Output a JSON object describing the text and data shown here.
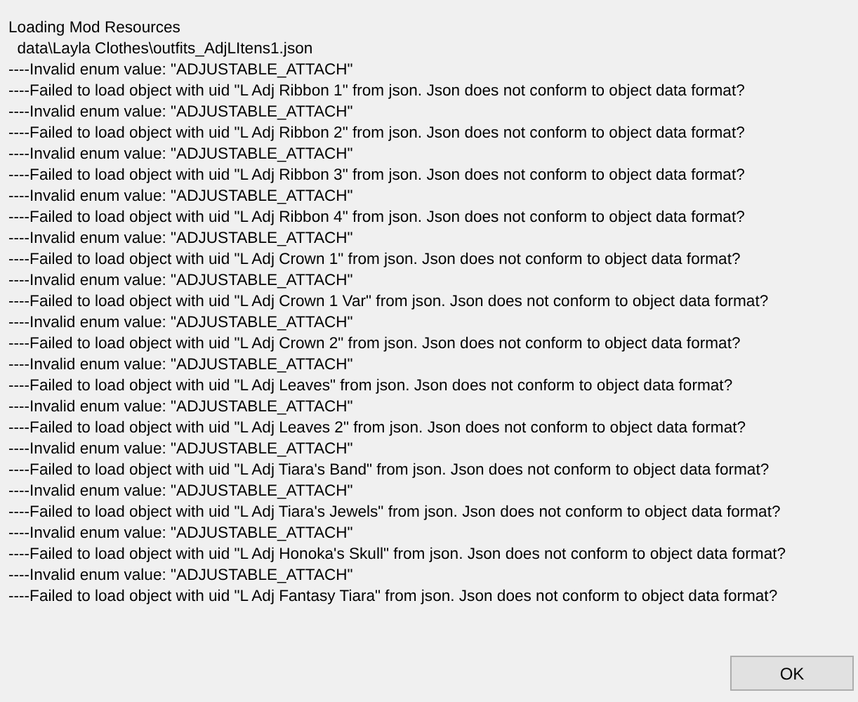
{
  "message": {
    "lines": [
      "Loading Mod Resources",
      "  data\\Layla Clothes\\outfits_AdjLItens1.json",
      "----Invalid enum value: \"ADJUSTABLE_ATTACH\"",
      "----Failed to load object with uid \"L Adj Ribbon 1\" from json. Json does not conform to object data format?",
      "----Invalid enum value: \"ADJUSTABLE_ATTACH\"",
      "----Failed to load object with uid \"L Adj Ribbon 2\" from json. Json does not conform to object data format?",
      "----Invalid enum value: \"ADJUSTABLE_ATTACH\"",
      "----Failed to load object with uid \"L Adj Ribbon 3\" from json. Json does not conform to object data format?",
      "----Invalid enum value: \"ADJUSTABLE_ATTACH\"",
      "----Failed to load object with uid \"L Adj Ribbon 4\" from json. Json does not conform to object data format?",
      "----Invalid enum value: \"ADJUSTABLE_ATTACH\"",
      "----Failed to load object with uid \"L Adj Crown 1\" from json. Json does not conform to object data format?",
      "----Invalid enum value: \"ADJUSTABLE_ATTACH\"",
      "----Failed to load object with uid \"L Adj Crown 1 Var\" from json. Json does not conform to object data format?",
      "----Invalid enum value: \"ADJUSTABLE_ATTACH\"",
      "----Failed to load object with uid \"L Adj Crown 2\" from json. Json does not conform to object data format?",
      "----Invalid enum value: \"ADJUSTABLE_ATTACH\"",
      "----Failed to load object with uid \"L Adj Leaves\" from json. Json does not conform to object data format?",
      "----Invalid enum value: \"ADJUSTABLE_ATTACH\"",
      "----Failed to load object with uid \"L Adj Leaves 2\" from json. Json does not conform to object data format?",
      "----Invalid enum value: \"ADJUSTABLE_ATTACH\"",
      "----Failed to load object with uid \"L Adj Tiara's Band\" from json. Json does not conform to object data format?",
      "----Invalid enum value: \"ADJUSTABLE_ATTACH\"",
      "----Failed to load object with uid \"L Adj Tiara's Jewels\" from json. Json does not conform to object data format?",
      "----Invalid enum value: \"ADJUSTABLE_ATTACH\"",
      "----Failed to load object with uid \"L Adj Honoka's Skull\" from json. Json does not conform to object data format?",
      "----Invalid enum value: \"ADJUSTABLE_ATTACH\"",
      "----Failed to load object with uid \"L Adj Fantasy Tiara\" from json. Json does not conform to object data format?"
    ]
  },
  "buttons": [
    "OK"
  ]
}
